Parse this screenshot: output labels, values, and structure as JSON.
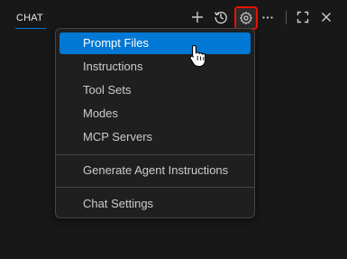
{
  "header": {
    "tab_label": "CHAT",
    "accent_color": "#0078d4",
    "highlight_color": "#e51400",
    "icons": [
      "plus-icon",
      "history-icon",
      "gear-icon",
      "ellipsis-icon",
      "maximize-icon",
      "close-icon"
    ]
  },
  "menu": {
    "items": [
      {
        "label": "Prompt Files"
      },
      {
        "label": "Instructions"
      },
      {
        "label": "Tool Sets"
      },
      {
        "label": "Modes"
      },
      {
        "label": "MCP Servers"
      },
      {
        "label": "Generate Agent Instructions"
      },
      {
        "label": "Chat Settings"
      }
    ],
    "active_index": 0
  }
}
